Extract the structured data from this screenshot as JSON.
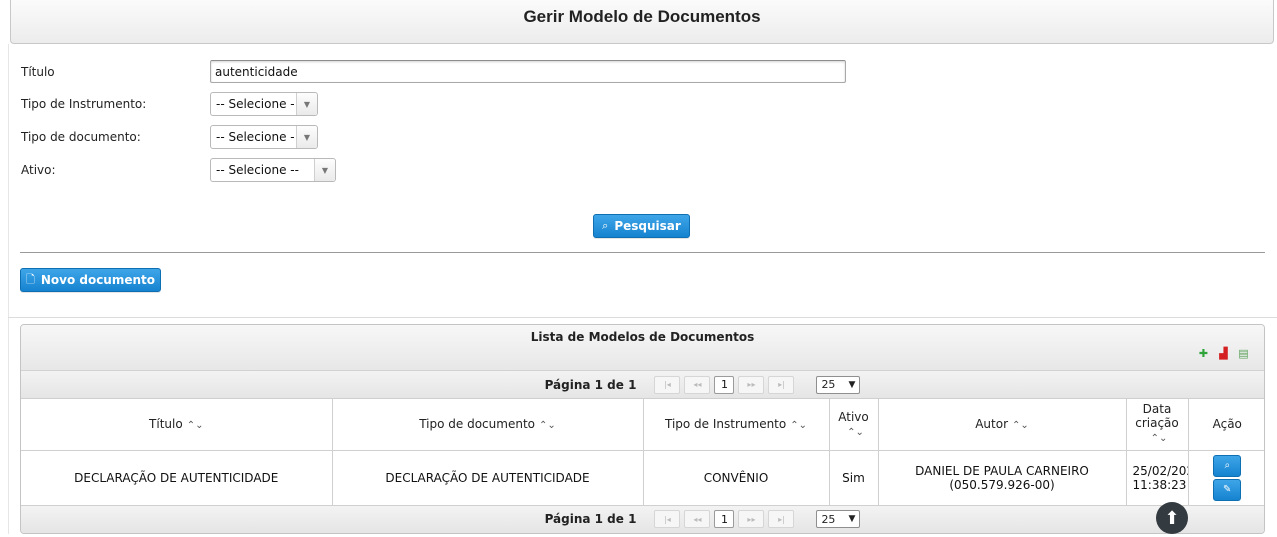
{
  "header": {
    "title": "Gerir Modelo de Documentos"
  },
  "form": {
    "titulo_label": "Título",
    "titulo_value": "autenticidade",
    "tipo_instrumento_label": "Tipo de Instrumento:",
    "tipo_instrumento_value": "-- Selecione --",
    "tipo_documento_label": "Tipo de documento:",
    "tipo_documento_value": "-- Selecione --",
    "ativo_label": "Ativo:",
    "ativo_value": "-- Selecione --",
    "search_button": "Pesquisar"
  },
  "toolbar": {
    "new_button": "Novo documento"
  },
  "grid": {
    "caption": "Lista de Modelos de Documentos",
    "export_icons": [
      "excel-icon",
      "pdf-icon",
      "print-icon"
    ],
    "paginator": {
      "label": "Página 1 de 1",
      "current_page": "1",
      "rows_per_page": "25"
    },
    "columns": [
      "Título",
      "Tipo de documento",
      "Tipo de Instrumento",
      "Ativo",
      "Autor",
      "Data criação",
      "Ação"
    ],
    "rows": [
      {
        "titulo": "DECLARAÇÃO DE AUTENTICIDADE",
        "tipo_documento": "DECLARAÇÃO DE AUTENTICIDADE",
        "tipo_instrumento": "CONVÊNIO",
        "ativo": "Sim",
        "autor_nome": "DANIEL DE PAULA CARNEIRO",
        "autor_cpf": "(050.579.926-00)",
        "data_criacao_date": "25/02/202",
        "data_criacao_time": "11:38:23"
      }
    ]
  },
  "colors": {
    "accent": "#1683d0",
    "header_bg": "#ececec"
  }
}
